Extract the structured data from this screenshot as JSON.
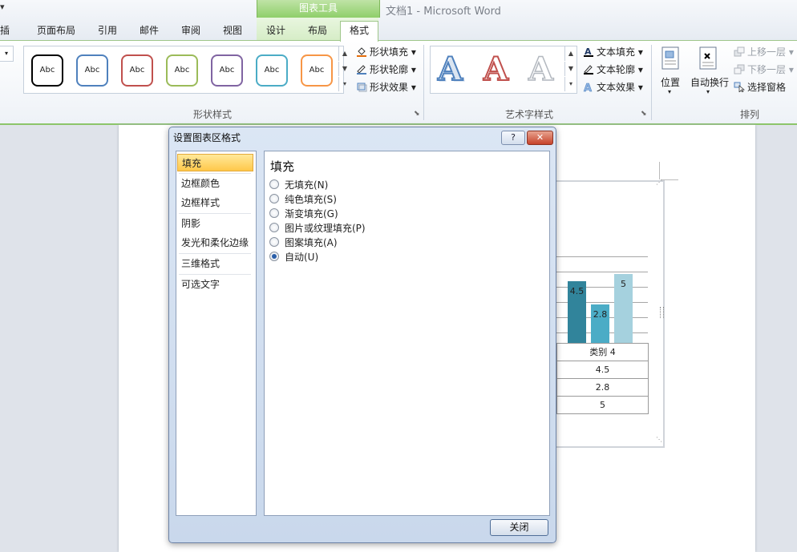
{
  "window": {
    "title": "文档1 - Microsoft Word",
    "qat_glyph": "▾"
  },
  "contextual_tab": {
    "label": "图表工具"
  },
  "tabs": [
    {
      "label": "插入"
    },
    {
      "label": "页面布局"
    },
    {
      "label": "引用"
    },
    {
      "label": "邮件"
    },
    {
      "label": "审阅"
    },
    {
      "label": "视图"
    },
    {
      "label": "设计"
    },
    {
      "label": "布局"
    },
    {
      "label": "格式"
    }
  ],
  "ribbon": {
    "shape_styles": {
      "label": "形状样式",
      "gallery": [
        {
          "text": "Abc",
          "color": "#000000"
        },
        {
          "text": "Abc",
          "color": "#4f81bd"
        },
        {
          "text": "Abc",
          "color": "#c0504d"
        },
        {
          "text": "Abc",
          "color": "#9bbb59"
        },
        {
          "text": "Abc",
          "color": "#8064a2"
        },
        {
          "text": "Abc",
          "color": "#4bacc6"
        },
        {
          "text": "Abc",
          "color": "#f79646"
        }
      ],
      "fill": "形状填充",
      "outline": "形状轮廓",
      "effects": "形状效果"
    },
    "wordart": {
      "label": "艺术字样式",
      "glyph": "A",
      "text_fill": "文本填充",
      "text_outline": "文本轮廓",
      "text_effects": "文本效果"
    },
    "arrange": {
      "label": "排列",
      "position": "位置",
      "wrap": "自动换行",
      "bring_forward": "上移一层",
      "send_backward": "下移一层",
      "selection_pane": "选择窗格"
    }
  },
  "chart": {
    "category": "类别 4",
    "bars": [
      {
        "value": 4.5,
        "label": "4.5",
        "color": "#31849b"
      },
      {
        "value": 2.8,
        "label": "2.8",
        "color": "#4bacc6"
      },
      {
        "value": 5,
        "label": "5",
        "color": "#a5d1de"
      }
    ],
    "table_values": [
      "4.5",
      "2.8",
      "5"
    ]
  },
  "dialog": {
    "title": "设置图表区格式",
    "help_glyph": "?",
    "close_glyph": "✕",
    "categories": [
      {
        "label": "填充",
        "selected": true
      },
      {
        "label": "边框颜色"
      },
      {
        "label": "边框样式"
      },
      {
        "label": "阴影"
      },
      {
        "label": "发光和柔化边缘"
      },
      {
        "label": "三维格式"
      },
      {
        "label": "可选文字"
      }
    ],
    "section_title": "填充",
    "options": [
      {
        "label": "无填充(N)",
        "checked": false
      },
      {
        "label": "纯色填充(S)",
        "checked": false
      },
      {
        "label": "渐变填充(G)",
        "checked": false
      },
      {
        "label": "图片或纹理填充(P)",
        "checked": false
      },
      {
        "label": "图案填充(A)",
        "checked": false
      },
      {
        "label": "自动(U)",
        "checked": true
      }
    ],
    "close_label": "关闭"
  }
}
